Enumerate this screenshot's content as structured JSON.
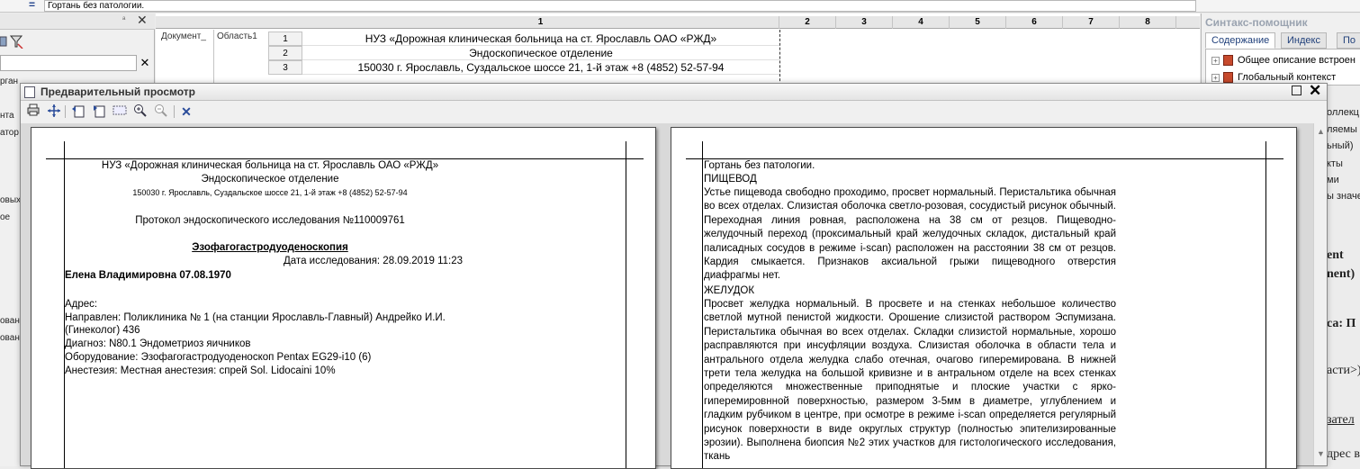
{
  "formula_bar": {
    "eq": "=",
    "value": "Гортань без патологии."
  },
  "left_panel": {
    "pin": "ᵃ",
    "close": "✕",
    "search_clear": "✕",
    "fragments": [
      "рган",
      "нта",
      "атор",
      "овых",
      "ое",
      "ован",
      "ован"
    ]
  },
  "sheet": {
    "columns": [
      "1",
      "2",
      "3",
      "4",
      "5",
      "6",
      "7",
      "8"
    ],
    "group_headers": [
      "Документ_",
      "Область1"
    ],
    "rows": [
      {
        "num": "1",
        "text": "НУЗ «Дорожная клиническая больница на ст. Ярославль ОАО «РЖД»"
      },
      {
        "num": "2",
        "text": "Эндоскопическое отделение"
      },
      {
        "num": "3",
        "text": "150030 г. Ярославль, Суздальское шоссе 21, 1-й этаж +8 (4852) 52-57-94"
      }
    ]
  },
  "syntax_helper": {
    "title": "Синтакс-помощник",
    "tabs": [
      "Содержание",
      "Индекс",
      "По"
    ],
    "tree": [
      "Общее описание встроен",
      "Глобальный контекст"
    ]
  },
  "right_fragments": {
    "small": [
      "оллекц",
      "ляемы",
      "ьный)",
      "кты",
      "ми",
      "ы значе"
    ],
    "bold": [
      "ent",
      "nent)",
      "са: П",
      "асти>)",
      "зател",
      "дрес в"
    ]
  },
  "preview": {
    "title": "Предварительный просмотр",
    "toolbar": [
      "print-icon",
      "move-icon",
      "page-back-icon",
      "page-forward-icon",
      "page-grid-icon",
      "zoom-in-icon",
      "zoom-out-icon",
      "close-icon"
    ],
    "page1": {
      "hospital": "НУЗ «Дорожная клиническая больница на ст. Ярославль ОАО «РЖД»",
      "department": "Эндоскопическое отделение",
      "address": "150030 г. Ярославль, Суздальское шоссе 21, 1-й этаж +8 (4852) 52-57-94",
      "protocol": "Протокол эндоскопического исследования №110009761",
      "procedure": "Эзофагогастродуоденоскопия",
      "date": "Дата исследования: 28.09.2019 11:23",
      "patient": "Елена Владимировна 07.08.1970",
      "lines": [
        "Адрес:",
        "Направлен: Поликлиника № 1 (на станции Ярославль-Главный) Андрейко И.И.",
        "(Гинеколог) 436",
        "Диагноз: N80.1 Эндометриоз яичников",
        "Оборудование: Эзофагогастродуоденоскоп Pentax EG29-i10 (6)",
        "Анестезия: Местная анестезия: спрей Sol. Lidocaini 10%"
      ]
    },
    "page2": {
      "larynx": "Гортань без патологии.",
      "esophagus_head": "ПИЩЕВОД",
      "esophagus_text": "Устье пищевода свободно проходимо, просвет нормальный. Перистальтика обычная во всех отделах. Слизистая оболочка светло-розовая, сосудистый рисунок обычный. Переходная линия ровная, расположена на 38 см от резцов. Пищеводно-желудочный переход (проксимальный край желудочных складок, дистальный край палисадных сосудов в режиме i-scan) расположен на расстоянии 38 см от резцов. Кардия смыкается. Признаков аксиальной грыжи пищеводного отверстия диафрагмы нет.",
      "stomach_head": "ЖЕЛУДОК",
      "stomach_text": "Просвет желудка нормальный. В просвете и на стенках небольшое количество светлой мутной пенистой жидкости. Орошение слизистой раствором Эспумизана. Перистальтика обычная во всех отделах. Складки слизистой нормальные, хорошо расправляются при инсуфляции воздуха. Слизистая оболочка в области тела и антрального отдела желудка слабо отечная, очагово гиперемирована. В нижней трети тела желудка на большой кривизне и в антральном отделе на всех стенках определяются множественные приподнятые и плоские участки с ярко-гиперемировнной поверхностью, размером 3-5мм в диаметре, углублением и гладким рубчиком в центре, при осмотре в режиме i-scan определяется регулярный рисунок поверхности в виде округлых структур (полностью эпителизированные эрозии). Выполнена биопсия №2 этих участков для гистологического исследования, ткань"
    }
  }
}
